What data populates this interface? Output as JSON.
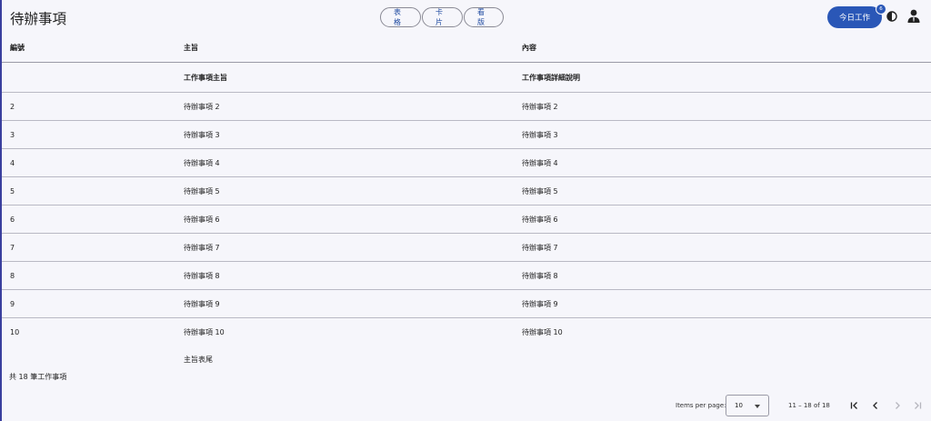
{
  "header": {
    "title": "待辦事項",
    "views": {
      "table": "表格",
      "card": "卡片",
      "board": "看版"
    },
    "today_button": "今日工作",
    "today_badge": "6"
  },
  "table": {
    "columns": {
      "no": "編號",
      "subject": "主旨",
      "content": "內容"
    },
    "filter_row": {
      "no": "",
      "subject": "工作事項主旨",
      "content": "工作事項詳細說明"
    },
    "rows": [
      {
        "no": "2",
        "subject": "待辦事項 2",
        "content": "待辦事項 2"
      },
      {
        "no": "3",
        "subject": "待辦事項 3",
        "content": "待辦事項 3"
      },
      {
        "no": "4",
        "subject": "待辦事項 4",
        "content": "待辦事項 4"
      },
      {
        "no": "5",
        "subject": "待辦事項 5",
        "content": "待辦事項 5"
      },
      {
        "no": "6",
        "subject": "待辦事項 6",
        "content": "待辦事項 6"
      },
      {
        "no": "7",
        "subject": "待辦事項 7",
        "content": "待辦事項 7"
      },
      {
        "no": "8",
        "subject": "待辦事項 8",
        "content": "待辦事項 8"
      },
      {
        "no": "9",
        "subject": "待辦事項 9",
        "content": "待辦事項 9"
      },
      {
        "no": "10",
        "subject": "待辦事項 10",
        "content": "待辦事項 10"
      }
    ],
    "footer": {
      "no": "",
      "subject": "主旨表尾",
      "content": ""
    }
  },
  "summary": "共 18 筆工作事項",
  "paginator": {
    "items_per_page_label": "Items per page:",
    "page_size": "10",
    "range_label": "11 – 18 of 18"
  },
  "icons": {
    "theme": "contrast-icon",
    "user": "account-icon",
    "first": "first-page-icon",
    "prev": "chevron-left-icon",
    "next": "chevron-right-icon",
    "last": "last-page-icon"
  },
  "colors": {
    "accent": "#2a57b7",
    "background": "#f6f6fb",
    "link": "#1f4aa0"
  }
}
